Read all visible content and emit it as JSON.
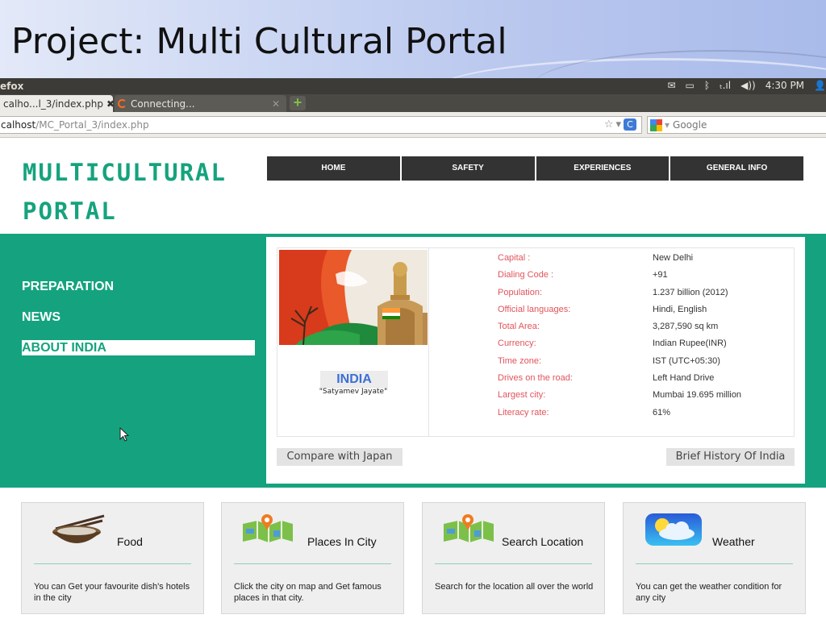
{
  "slide": {
    "title": "Project: Multi Cultural Portal"
  },
  "os": {
    "app_name": "efox",
    "tray": {
      "mail": "✉",
      "battery": "▭",
      "bluetooth": "ᛒ",
      "signal": "ₜ.ıl",
      "volume": "◀))",
      "time": "4:30 PM",
      "user": "👤"
    }
  },
  "browser": {
    "tabs": [
      {
        "label": "calho...l_3/index.php",
        "close": "✖"
      },
      {
        "label": "Connecting...",
        "close": "✕"
      }
    ],
    "new_tab": "+",
    "url": {
      "host": "calhost",
      "path": "/MC_Portal_3/index.php"
    },
    "url_icons": {
      "star": "☆",
      "dropdown": "▾",
      "refresh": "C"
    },
    "search": {
      "engine_dropdown": "▾",
      "placeholder": "Google"
    }
  },
  "site": {
    "logo_line1": "MULTICULTURAL",
    "logo_line2": "PORTAL",
    "nav": [
      "HOME",
      "SAFETY",
      "EXPERIENCES",
      "GENERAL INFO"
    ],
    "side_menu": [
      {
        "label": "PREPARATION",
        "active": false
      },
      {
        "label": "NEWS",
        "active": false
      },
      {
        "label": "ABOUT INDIA",
        "active": true
      }
    ],
    "country": {
      "name": "INDIA",
      "motto": "\"Satyamev Jayate\"",
      "facts": [
        {
          "key": "Capital :",
          "value": "New Delhi"
        },
        {
          "key": "Dialing Code :",
          "value": "+91"
        },
        {
          "key": "Population:",
          "value": "1.237 billion (2012)"
        },
        {
          "key": "Official languages:",
          "value": "Hindi, English"
        },
        {
          "key": "Total Area:",
          "value": "3,287,590 sq km"
        },
        {
          "key": "Currency:",
          "value": "Indian Rupee(INR)"
        },
        {
          "key": "Time zone:",
          "value": "IST (UTC+05:30)"
        },
        {
          "key": "Drives on the road:",
          "value": "Left Hand Drive"
        },
        {
          "key": "Largest city:",
          "value": "Mumbai 19.695 million"
        },
        {
          "key": "Literacy rate:",
          "value": "61%"
        }
      ]
    },
    "buttons": {
      "compare": "Compare with Japan",
      "history": "Brief History Of India"
    },
    "cards": [
      {
        "title": "Food",
        "desc": "You can Get your favourite dish's hotels in the city",
        "icon": "food-bowl-icon"
      },
      {
        "title": "Places In City",
        "desc": "Click the city on map and Get famous places in that city.",
        "icon": "map-pin-icon"
      },
      {
        "title": "Search Location",
        "desc": "Search for the location all over the world",
        "icon": "map-pin-icon"
      },
      {
        "title": "Weather",
        "desc": "You can get the weather condition for any city",
        "icon": "weather-cloud-icon"
      }
    ]
  }
}
